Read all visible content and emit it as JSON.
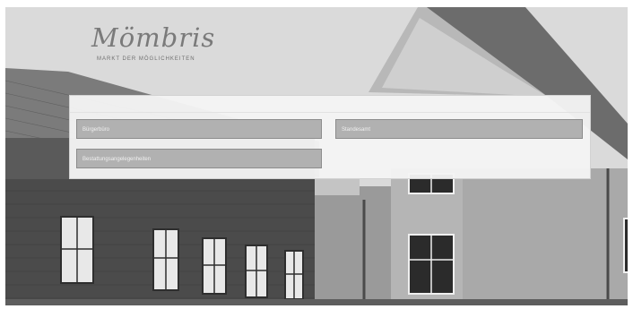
{
  "logo": {
    "wordmark": "Mömbris",
    "tagline": "MARKT DER MÖGLICHKEITEN"
  },
  "services": [
    {
      "label": "Bürgerbüro"
    },
    {
      "label": "Standesamt"
    },
    {
      "label": "Bestattungsangelegenheiten"
    }
  ]
}
